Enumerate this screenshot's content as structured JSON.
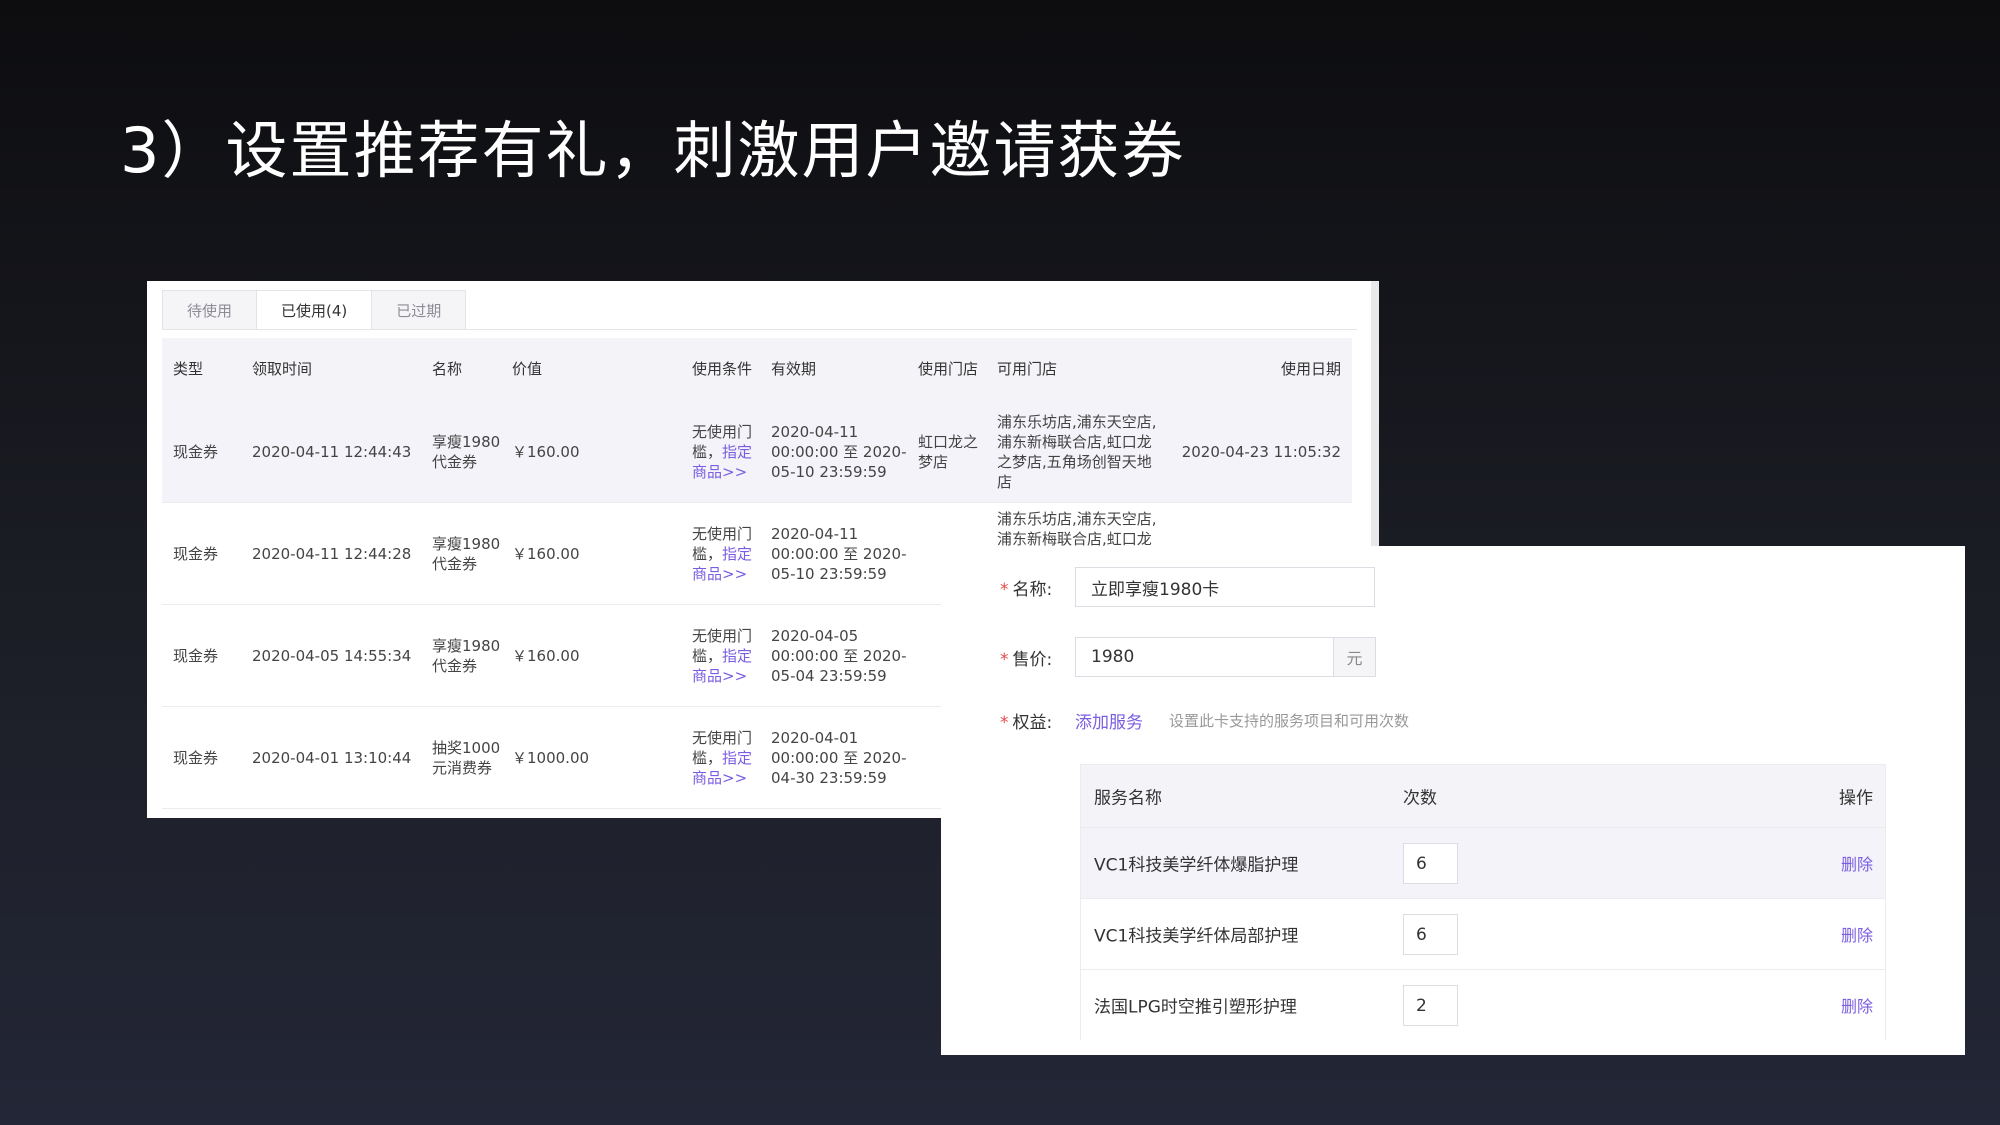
{
  "slide": {
    "title": "3）设置推荐有礼，刺激用户邀请获券"
  },
  "coupons": {
    "tabs": [
      "待使用",
      "已使用(4)",
      "已过期"
    ],
    "headers": {
      "type": "类型",
      "received": "领取时间",
      "name": "名称",
      "value": "价值",
      "condition": "使用条件",
      "validity": "有效期",
      "used_store": "使用门店",
      "available_stores": "可用门店",
      "used_date": "使用日期"
    },
    "rows": [
      {
        "type": "现金券",
        "received": "2020-04-11 12:44:43",
        "name_l1": "享瘦1980",
        "name_l2": "代金券",
        "value": "￥160.00",
        "cond_l1": "无使用门",
        "cond_l2": "槛，",
        "cond_link1": "指定",
        "cond_link2": "商品>>",
        "valid_l1": "2020-04-11",
        "valid_l2": "00:00:00 至 2020-",
        "valid_l3": "05-10 23:59:59",
        "store_l1": "虹口龙之",
        "store_l2": "梦店",
        "avail_l1": "浦东乐坊店,浦东天空店,",
        "avail_l2": "浦东新梅联合店,虹口龙",
        "avail_l3": "之梦店,五角场创智天地",
        "avail_l4": "店",
        "used_date": "2020-04-23 11:05:32"
      },
      {
        "type": "现金券",
        "received": "2020-04-11 12:44:28",
        "name_l1": "享瘦1980",
        "name_l2": "代金券",
        "value": "￥160.00",
        "cond_l1": "无使用门",
        "cond_l2": "槛，",
        "cond_link1": "指定",
        "cond_link2": "商品>>",
        "valid_l1": "2020-04-11",
        "valid_l2": "00:00:00 至 2020-",
        "valid_l3": "05-10 23:59:59",
        "avail_l1": "浦东乐坊店,浦东天空店,",
        "avail_l2": "浦东新梅联合店,虹口龙"
      },
      {
        "type": "现金券",
        "received": "2020-04-05 14:55:34",
        "name_l1": "享瘦1980",
        "name_l2": "代金券",
        "value": "￥160.00",
        "cond_l1": "无使用门",
        "cond_l2": "槛，",
        "cond_link1": "指定",
        "cond_link2": "商品>>",
        "valid_l1": "2020-04-05",
        "valid_l2": "00:00:00 至 2020-",
        "valid_l3": "05-04 23:59:59"
      },
      {
        "type": "现金券",
        "received": "2020-04-01 13:10:44",
        "name_l1": "抽奖1000",
        "name_l2": "元消费券",
        "value": "￥1000.00",
        "cond_l1": "无使用门",
        "cond_l2": "槛，",
        "cond_link1": "指定",
        "cond_link2": "商品>>",
        "valid_l1": "2020-04-01",
        "valid_l2": "00:00:00 至 2020-",
        "valid_l3": "04-30 23:59:59"
      }
    ]
  },
  "card_form": {
    "name": {
      "label": "名称:",
      "value": "立即享瘦1980卡"
    },
    "price": {
      "label": "售价:",
      "value": "1980",
      "unit": "元"
    },
    "benefits": {
      "label": "权益:",
      "add_link": "添加服务",
      "hint": "设置此卡支持的服务项目和可用次数"
    },
    "table": {
      "headers": {
        "service": "服务名称",
        "count": "次数",
        "action": "操作"
      },
      "rows": [
        {
          "service": "VC1科技美学纤体爆脂护理",
          "count": "6",
          "action": "删除"
        },
        {
          "service": "VC1科技美学纤体局部护理",
          "count": "6",
          "action": "删除"
        },
        {
          "service": "法国LPG时空推引塑形护理",
          "count": "2",
          "action": "删除"
        }
      ]
    }
  }
}
